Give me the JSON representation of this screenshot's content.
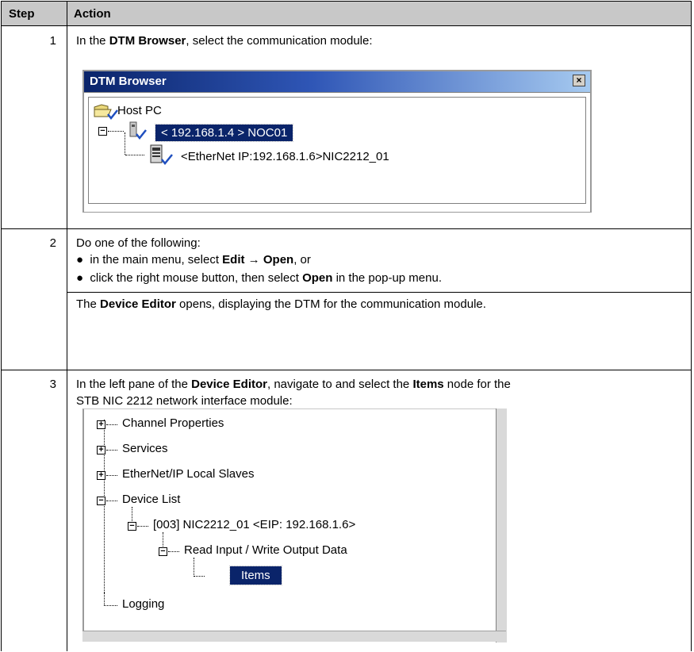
{
  "table": {
    "header": {
      "step": "Step",
      "action": "Action"
    },
    "rows": [
      {
        "step": "1",
        "text_before": "In the ",
        "bold1": "DTM Browser",
        "text_after": ", select the communication module:"
      },
      {
        "step": "2",
        "intro": "Do one of the following:",
        "bullet1": {
          "pre": "in the main menu, select ",
          "bold": "Edit",
          "arrow": " → ",
          "bold2": "Open",
          "post": ", or"
        },
        "bullet2": {
          "pre": "click the right mouse button, then select ",
          "bold": "Open",
          "post": " in the pop-up menu."
        },
        "result": {
          "pre": "The ",
          "bold": "Device Editor",
          "post": " opens, displaying the DTM for the communication module."
        }
      },
      {
        "step": "3",
        "line1": {
          "pre": "In the left pane of the ",
          "bold": "Device Editor",
          "mid": ", navigate to and select the ",
          "bold2": "Items",
          "post": " node for the"
        },
        "line2": "STB NIC 2212 network interface module:"
      }
    ]
  },
  "dtm_browser": {
    "title": "DTM Browser",
    "close_glyph": "×",
    "host": "Host PC",
    "noc": "< 192.168.1.4 > NOC01",
    "nic": "<EtherNet IP:192.168.1.6>NIC2212_01"
  },
  "tree": {
    "channel": "Channel Properties",
    "services": "Services",
    "ethernet_slaves": "EtherNet/IP Local Slaves",
    "device_list": "Device List",
    "device": "[003] NIC2212_01 <EIP: 192.168.1.6>",
    "rw_data": "Read Input / Write Output Data",
    "items": "Items",
    "logging": "Logging"
  },
  "colors": {
    "header_bg": "#c8c8c8",
    "selection": "#0a246a",
    "title_bar": "#0a246a"
  }
}
